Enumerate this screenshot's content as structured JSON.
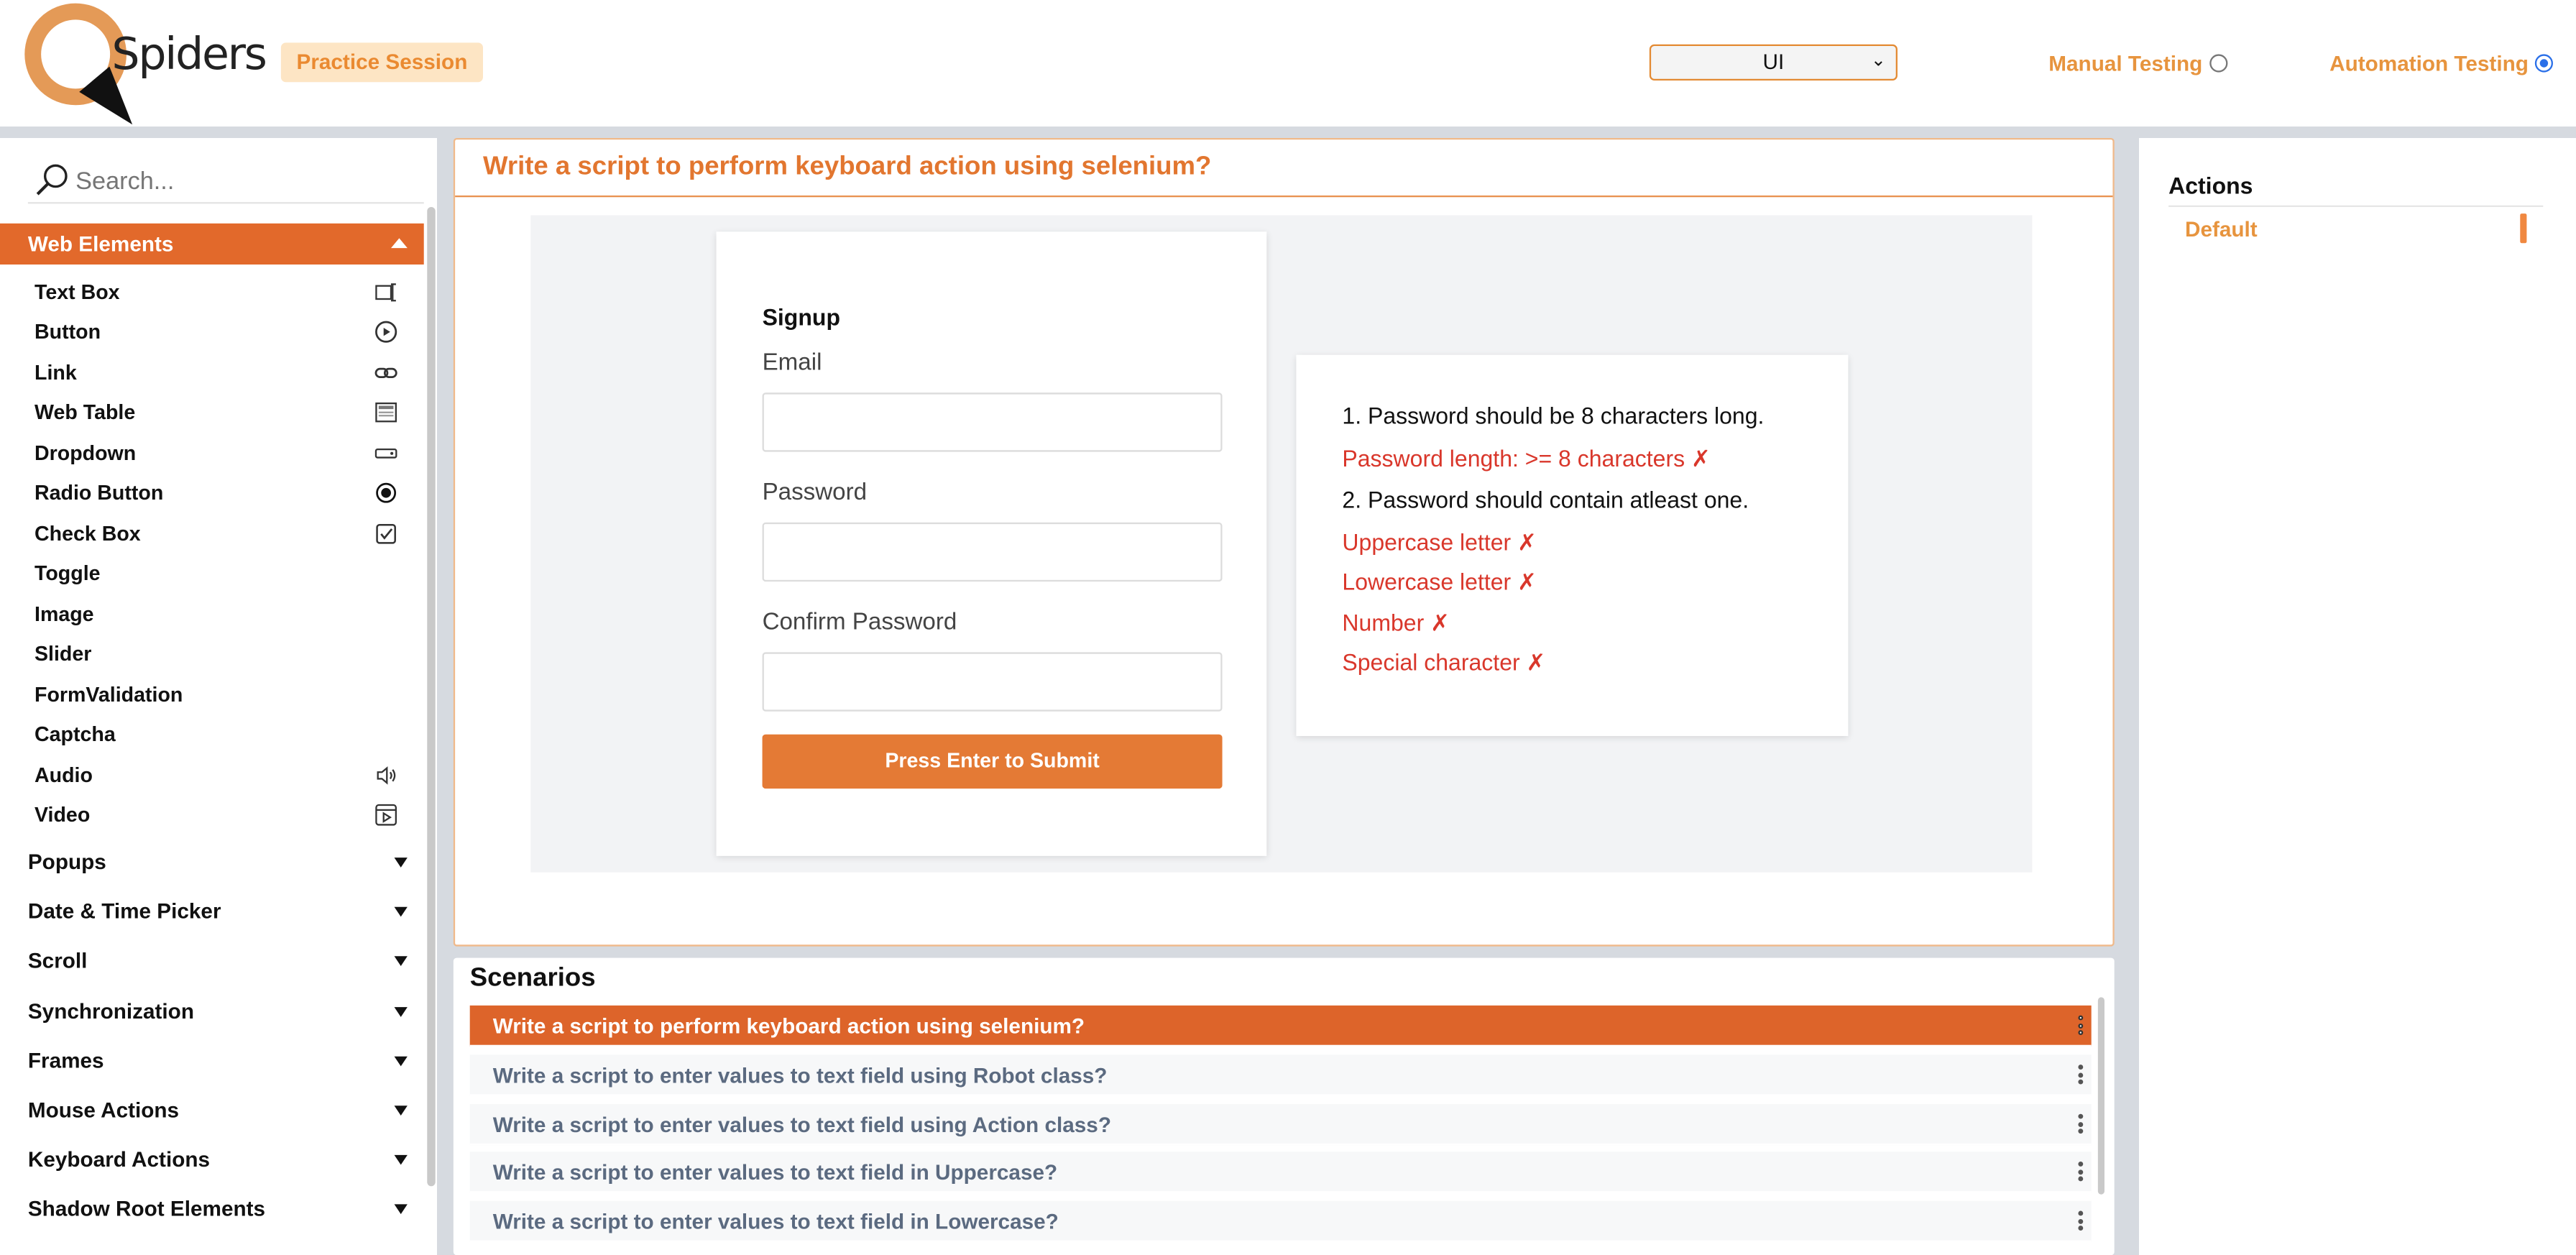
{
  "header": {
    "logo_text": "Spiders",
    "practice_label": "Practice Session",
    "select_value": "UI",
    "manual_label": "Manual Testing",
    "automation_label": "Automation Testing"
  },
  "sidebar": {
    "search_placeholder": "Search...",
    "active_group": "Web Elements",
    "items": [
      {
        "label": "Text Box",
        "icon": "text-box-icon"
      },
      {
        "label": "Button",
        "icon": "play-circle-icon"
      },
      {
        "label": "Link",
        "icon": "link-icon"
      },
      {
        "label": "Web Table",
        "icon": "table-icon"
      },
      {
        "label": "Dropdown",
        "icon": "dropdown-icon"
      },
      {
        "label": "Radio Button",
        "icon": "radio-icon"
      },
      {
        "label": "Check Box",
        "icon": "checkbox-icon"
      },
      {
        "label": "Toggle",
        "icon": ""
      },
      {
        "label": "Image",
        "icon": ""
      },
      {
        "label": "Slider",
        "icon": ""
      },
      {
        "label": "FormValidation",
        "icon": ""
      },
      {
        "label": "Captcha",
        "icon": ""
      },
      {
        "label": "Audio",
        "icon": "speaker-icon"
      },
      {
        "label": "Video",
        "icon": "video-icon"
      }
    ],
    "groups": [
      "Popups",
      "Date & Time Picker",
      "Scroll",
      "Synchronization",
      "Frames",
      "Mouse Actions",
      "Keyboard Actions",
      "Shadow Root Elements"
    ]
  },
  "main": {
    "title": "Write a script to perform keyboard action using selenium?",
    "signup": {
      "title": "Signup",
      "email_label": "Email",
      "password_label": "Password",
      "confirm_label": "Confirm Password",
      "submit_label": "Press Enter to Submit"
    },
    "rules": {
      "rule1": "1. Password should be 8 characters long.",
      "length": "Password length: >= 8 characters ✗",
      "rule2": "2. Password should contain atleast one.",
      "upper": "Uppercase letter ✗",
      "lower": "Lowercase letter ✗",
      "number": "Number ✗",
      "special": "Special character ✗"
    }
  },
  "scenarios": {
    "title": "Scenarios",
    "items": [
      "Write a script to perform keyboard action using selenium?",
      "Write a script to enter values to text field using Robot class?",
      "Write a script to enter values to text field using Action class?",
      "Write a script to enter values to text field in Uppercase?",
      "Write a script to enter values to text field in Lowercase?"
    ]
  },
  "actions": {
    "title": "Actions",
    "default_label": "Default"
  },
  "colors": {
    "accent": "#e2692b",
    "error": "#d9372b",
    "link_orange": "#e7943e"
  }
}
